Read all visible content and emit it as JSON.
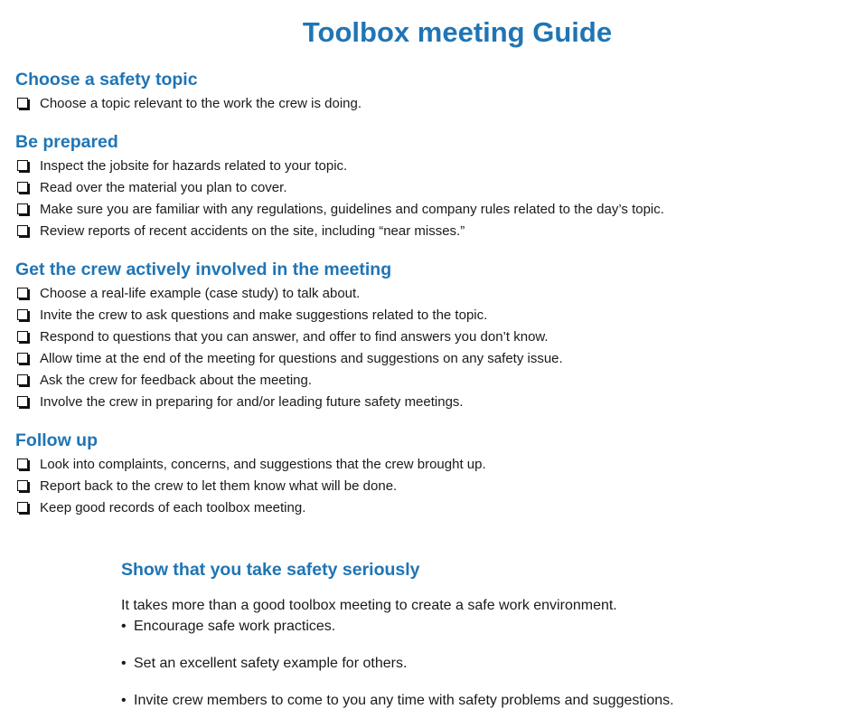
{
  "title": "Toolbox meeting Guide",
  "sections": [
    {
      "heading": "Choose a safety topic",
      "items": [
        "Choose a topic relevant to the work the crew is doing."
      ]
    },
    {
      "heading": "Be prepared",
      "items": [
        "Inspect the jobsite for hazards related to your topic.",
        "Read over the material you plan to cover.",
        "Make sure you are familiar with any regulations, guidelines and company rules related to the day’s topic.",
        "Review reports of recent accidents on the site, including “near misses.”"
      ]
    },
    {
      "heading": "Get the crew actively involved in the meeting",
      "items": [
        "Choose a real-life example (case study) to talk about.",
        "Invite the crew to ask questions and make suggestions related to the topic.",
        "Respond to questions that you can answer, and offer to find answers you don’t know.",
        "Allow time at the end of the meeting for questions and suggestions on any safety issue.",
        "Ask the crew for feedback about the meeting.",
        "Involve the crew in preparing for and/or leading future safety meetings."
      ]
    },
    {
      "heading": "Follow up",
      "items": [
        "Look into complaints, concerns, and suggestions that the crew brought up.",
        "Report back to the crew to let them know what will be done.",
        "Keep good records of each toolbox meeting."
      ]
    }
  ],
  "panel": {
    "heading": "Show that you take safety seriously",
    "intro": "It takes more than a good toolbox meeting to create a safe work environment.",
    "bullet_char": "•",
    "bullets": [
      "Encourage safe work practices.",
      "Set an excellent safety example for others.",
      "Invite crew members to come to you any time with safety problems and suggestions."
    ]
  }
}
